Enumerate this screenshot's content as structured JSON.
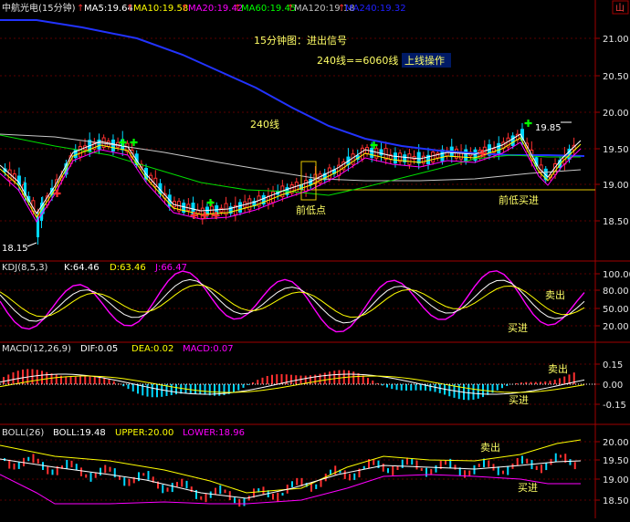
{
  "header": {
    "security": "中航光电(15分钟)",
    "ma": [
      {
        "label": "MA5:19.64",
        "color": "#ffffff"
      },
      {
        "label": "MA10:19.58",
        "color": "#ffff00"
      },
      {
        "label": "MA20:19.42",
        "color": "#ff00ff"
      },
      {
        "label": "MA60:19.45",
        "color": "#00ff00"
      },
      {
        "label": "MA120:19.18",
        "color": "#c0c0c0"
      },
      {
        "label": "MA240:19.32",
        "color": "#2020ff"
      }
    ],
    "badge": "山"
  },
  "annotations": {
    "title": "15分钟图：进出信号",
    "line_rule": "240线==6060线",
    "action": "上线操作",
    "ma240_label": "240线",
    "low_point": "前低点",
    "low_buy": "前低买进",
    "high_value": "19.85",
    "low_value": "18.15"
  },
  "kdj": {
    "legend": [
      {
        "label": "KDJ(8,5,3)",
        "color": "#e0e0e0"
      },
      {
        "label": "K:64.46",
        "color": "#ffffff"
      },
      {
        "label": "D:63.46",
        "color": "#ffff00"
      },
      {
        "label": "J:66.47",
        "color": "#ff00ff"
      }
    ],
    "sell": "卖出",
    "buy": "买进",
    "ticks": [
      "100.00",
      "80.00",
      "50.00",
      "20.00"
    ]
  },
  "macd": {
    "legend": [
      {
        "label": "MACD(12,26,9)",
        "color": "#e0e0e0"
      },
      {
        "label": "DIF:0.05",
        "color": "#ffffff"
      },
      {
        "label": "DEA:0.02",
        "color": "#ffff00"
      },
      {
        "label": "MACD:0.07",
        "color": "#ff00ff"
      }
    ],
    "sell": "卖出",
    "buy": "买进",
    "ticks": [
      "0.15",
      "0.00",
      "-0.15"
    ]
  },
  "boll": {
    "legend": [
      {
        "label": "BOLL(26)",
        "color": "#e0e0e0"
      },
      {
        "label": "BOLL:19.48",
        "color": "#ffffff"
      },
      {
        "label": "UPPER:20.00",
        "color": "#ffff00"
      },
      {
        "label": "LOWER:18.96",
        "color": "#ff00ff"
      }
    ],
    "sell": "卖出",
    "buy": "买进",
    "ticks": [
      "20.00",
      "19.50",
      "19.00",
      "18.50"
    ]
  },
  "price_ticks": [
    "21.00",
    "20.50",
    "20.00",
    "19.50",
    "19.00",
    "18.50"
  ],
  "colors": {
    "up": "#ff3030",
    "down": "#00d8ff",
    "grid": "#8b0000",
    "support": "#e6c600"
  },
  "chart_data": {
    "type": "candlestick",
    "interval": "15分钟",
    "price_range": [
      18.1,
      21.2
    ],
    "support_level": 18.92,
    "ma_lines": [
      "MA5",
      "MA10",
      "MA20",
      "MA60",
      "MA120",
      "MA240"
    ],
    "last_values": {
      "MA5": 19.64,
      "MA10": 19.58,
      "MA20": 19.42,
      "MA60": 19.45,
      "MA120": 19.18,
      "MA240": 19.32
    },
    "indicators": {
      "KDJ": {
        "K": 64.46,
        "D": 63.46,
        "J": 66.47,
        "ylim": [
          0,
          100
        ]
      },
      "MACD": {
        "DIF": 0.05,
        "DEA": 0.02,
        "MACD": 0.07
      },
      "BOLL": {
        "BOLL": 19.48,
        "UPPER": 20.0,
        "LOWER": 18.96
      }
    }
  }
}
